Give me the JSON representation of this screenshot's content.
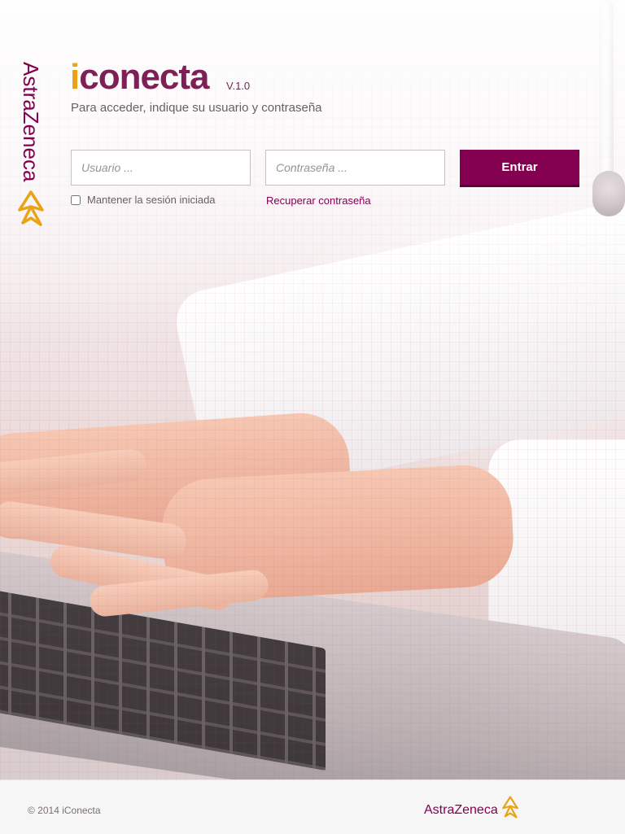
{
  "brand": {
    "name": "AstraZeneca",
    "primary_color": "#830051",
    "accent_color": "#e8a317",
    "logo_icon": "astrazeneca-logo-icon"
  },
  "header": {
    "title_first_letter": "i",
    "title_rest": "conecta",
    "version": "V.1.0",
    "subtitle": "Para acceder, indique su usuario y contraseña"
  },
  "login_form": {
    "username_placeholder": "Usuario ...",
    "username_value": "",
    "password_placeholder": "Contraseña ...",
    "password_value": "",
    "submit_label": "Entrar",
    "remember_label": "Mantener la sesión iniciada",
    "remember_checked": false,
    "recover_label": "Recuperar contraseña"
  },
  "footer": {
    "copyright": "© 2014 iConecta",
    "brand_name": "AstraZeneca"
  }
}
